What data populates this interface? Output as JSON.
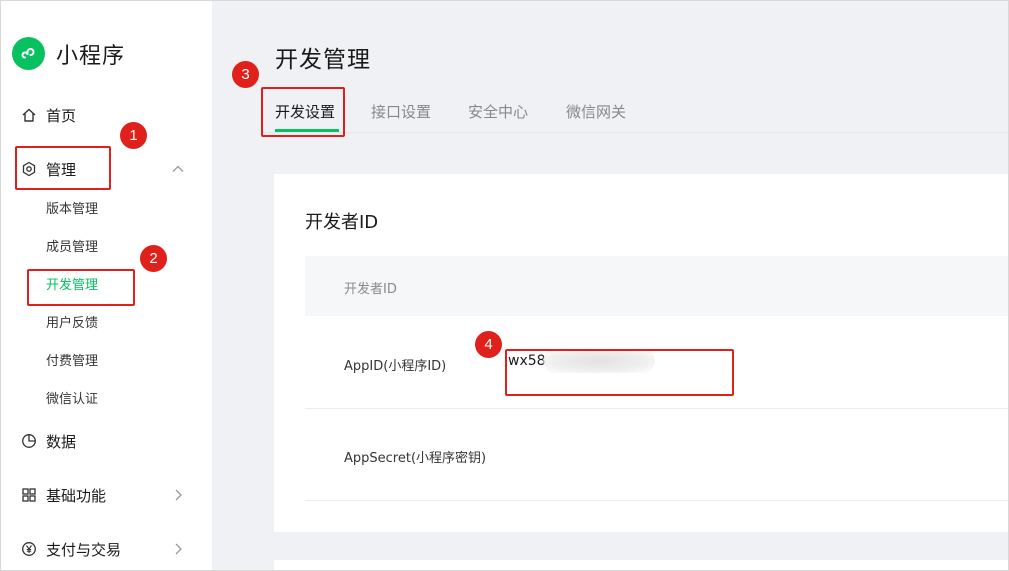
{
  "brand": {
    "title": "小程序",
    "logo_icon": "mini-program-logo-icon",
    "logo_color": "#07c160"
  },
  "sidebar": {
    "items": [
      {
        "label": "首页",
        "icon": "home-icon"
      },
      {
        "label": "管理",
        "icon": "hexagon-settings-icon",
        "expanded": true
      },
      {
        "label": "数据",
        "icon": "pie-chart-icon"
      },
      {
        "label": "基础功能",
        "icon": "grid-icon"
      },
      {
        "label": "支付与交易",
        "icon": "yen-coin-icon"
      }
    ],
    "sub_items": [
      {
        "label": "版本管理"
      },
      {
        "label": "成员管理"
      },
      {
        "label": "开发管理",
        "active": true
      },
      {
        "label": "用户反馈"
      },
      {
        "label": "付费管理"
      },
      {
        "label": "微信认证"
      }
    ]
  },
  "header": {
    "title": "开发管理",
    "tabs": [
      {
        "label": "开发设置",
        "active": true
      },
      {
        "label": "接口设置"
      },
      {
        "label": "安全中心"
      },
      {
        "label": "微信网关"
      }
    ]
  },
  "card": {
    "title": "开发者ID",
    "column_header": "开发者ID",
    "rows": [
      {
        "label": "AppID(小程序ID)",
        "value": "wx58"
      },
      {
        "label": "AppSecret(小程序密钥)",
        "value": ""
      }
    ]
  },
  "annotations": {
    "badges": [
      "1",
      "2",
      "3",
      "4"
    ],
    "color": "#e0201a"
  },
  "colors": {
    "accent": "#07c160",
    "background": "#f0f1f4"
  }
}
